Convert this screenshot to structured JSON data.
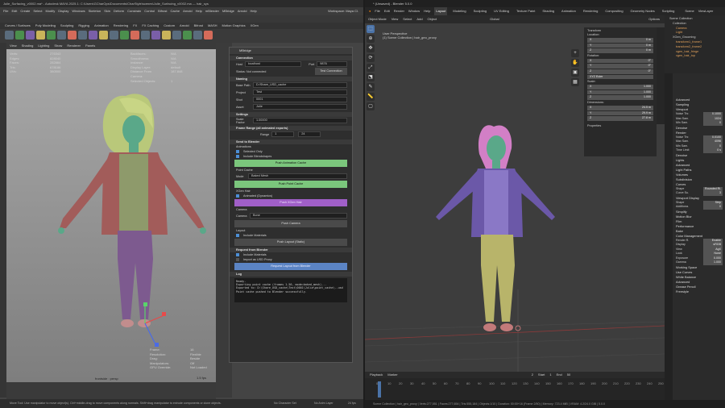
{
  "maya": {
    "title": "Julie_Surfacing_v0002.ma* - Autodesk MAYA 2025.1: C:\\Users\\GCharOps\\Documents\\CharStyle\\scenes\\Julie_Surfacing_v0002.ma --- hair_sys",
    "menu": [
      "File",
      "Edit",
      "Create",
      "Select",
      "Modify",
      "Display",
      "Windows",
      "Skeleton",
      "Skin",
      "Deform",
      "Constrain",
      "Control",
      "Bifrost",
      "Cache",
      "Arnold",
      "Help",
      "mBlender",
      "MBridge",
      "Arnold",
      "Help"
    ],
    "workspace": "Workspace: Maya Cl.",
    "shelf_tabs": [
      "Curves / Surfaces",
      "Poly Modeling",
      "Sculpting",
      "Rigging",
      "Animation",
      "Rendering",
      "FX",
      "FX Caching",
      "Custom",
      "Arnold",
      "Bifrost",
      "MASH",
      "Motion Graphics",
      "XGen",
      "TURTLE"
    ],
    "vp_menu": [
      "View",
      "Shading",
      "Lighting",
      "Show",
      "Renderer",
      "Panels"
    ],
    "hud": [
      [
        "Verts:",
        "276343",
        "",
        "Backfaces:",
        "N/A"
      ],
      [
        "Edges:",
        "828040",
        "",
        "Smoothness:",
        "N/A"
      ],
      [
        "Faces:",
        "282864",
        "",
        "Instance:",
        "N/A"
      ],
      [
        "Tris:",
        "678186",
        "",
        "Display Layer:",
        "default"
      ],
      [
        "UVs:",
        "380500",
        "",
        "Distance From Camera:",
        "187.848"
      ],
      [
        "",
        "",
        "",
        "Selected Objects:",
        "1"
      ]
    ],
    "hud_bottom": [
      [
        "Frame:",
        "16"
      ],
      [
        "Resolution:",
        "Flexible"
      ],
      [
        "Drag:",
        "Beside"
      ],
      [
        "Manipulators:",
        "Off"
      ],
      [
        "GPU Override:",
        "Not Loaded"
      ]
    ],
    "fps": "1.5 fps",
    "camera": "frontside : persp",
    "help": "Move Tool: Use manipulator to move object(s). Ctrl+middle-drag to move components along normals. Shift+drag manipulator to extrude components or clone objects.",
    "no_char_set": "No Character Set",
    "no_anim_layer": "No Anim Layer",
    "fps_end": "24 fps"
  },
  "mbridge": {
    "title": "MBridge",
    "connection": {
      "header": "Connection",
      "host_label": "Host",
      "host": "localhost",
      "port_label": "Port",
      "port": "9876",
      "status": "Status: Not connected",
      "test_btn": "Test Connection"
    },
    "naming": {
      "header": "Naming",
      "base_path_label": "Base Path",
      "base_path": "D:/Share_USD_cache",
      "project_label": "Project",
      "project": "Test",
      "shot_label": "Shot",
      "shot": "0001",
      "asset_label": "Asset",
      "asset": "Julie"
    },
    "settings": {
      "header": "Settings",
      "scale_label": "Scale Factor",
      "scale": "1.00000"
    },
    "frame_range": {
      "header": "Frame Range (all animated exports)",
      "range_label": "Range",
      "start": "1",
      "end": "24"
    },
    "send": {
      "header": "Send to Blender",
      "anim_label": "Animations",
      "sel_only": "Selected Only",
      "blendshapes": "Include Blendshapes",
      "push_anim": "Push Animation Cache",
      "point_cache": "Point Cache",
      "mode_label": "Mode",
      "mode": "Baked Mesh",
      "push_point": "Push Point Cache",
      "xgen_label": "XGen Hair",
      "animated": "Animated (Dynamics)",
      "push_xgen": "Push XGen Hair",
      "camera_label": "Camera",
      "camera_field": "Camera",
      "camera_val": "Bone",
      "push_camera": "Push Camera",
      "layout_label": "Layout",
      "incl_mat": "Include Materials",
      "push_layout": "Push Layout (Static)"
    },
    "request": {
      "header": "Request from Blender",
      "incl_mat": "Include Materials",
      "import_usd": "Import as USD Proxy",
      "btn": "Request Layout from Blender"
    },
    "log": {
      "header": "Log",
      "text": "Ready.\nExporting point cache (frames 1-50, mode=baked_mesh)...\nExported to: D:\\Share_USD_cache\\Test\\0001\\Julie\\point_cache\\..usd\nPoint cache pushed to Blender successfully."
    }
  },
  "blender": {
    "title": "* (Unsaved) - Blender 5.0.0",
    "menu": [
      "File",
      "Edit",
      "Render",
      "Window",
      "Help"
    ],
    "tabs": [
      "Layout",
      "Modeling",
      "Sculpting",
      "UV Editing",
      "Texture Paint",
      "Shading",
      "Animation",
      "Rendering",
      "Compositing",
      "Geometry Nodes",
      "Scripting"
    ],
    "active_tab": "Layout",
    "scene": "Scene",
    "view_layer": "ViewLayer",
    "header": [
      "Object Mode",
      "View",
      "Select",
      "Add",
      "Object"
    ],
    "global": "Global",
    "options": "Options",
    "vp_label": "User Perspective",
    "vp_sub": "(1) Scene Collection | hair_geo_proxy",
    "transform": {
      "header": "Transform",
      "location": "Location:",
      "loc": [
        [
          "X",
          "0 m"
        ],
        [
          "Y",
          "0 m"
        ],
        [
          "Z",
          "0 m"
        ]
      ],
      "rotation": "Rotation:",
      "rot": [
        [
          "X",
          "0°"
        ],
        [
          "Y",
          "0°"
        ],
        [
          "Z",
          "0°"
        ]
      ],
      "mode": "XYZ Euler",
      "scale": "Scale:",
      "scl": [
        [
          "X",
          "1.000"
        ],
        [
          "Y",
          "1.000"
        ],
        [
          "Z",
          "1.000"
        ]
      ],
      "dimensions": "Dimensions:",
      "dim": [
        [
          "X",
          "24.5 m"
        ],
        [
          "Y",
          "29.9 m"
        ],
        [
          "Z",
          "27.8 m"
        ]
      ],
      "properties": "Properties"
    },
    "outliner": [
      "Scene Collection",
      "Collection",
      "Camera",
      "Light",
      "XGen_Grooming",
      "transform1_frame1",
      "transform2_frame2",
      "xgen_hair_fringe",
      "xgen_hair_top"
    ],
    "props": [
      [
        "Advanced",
        ""
      ],
      [
        "Sampling",
        ""
      ],
      [
        "Viewport",
        ""
      ],
      [
        "Noise Thr.",
        "0.1000"
      ],
      [
        "Max Sam.",
        "1024"
      ],
      [
        "Min Sam.",
        "0"
      ],
      [
        "Denoise",
        ""
      ],
      [
        "Render",
        ""
      ],
      [
        "Noise Thr.",
        "0.0100"
      ],
      [
        "Max Sam.",
        "4096"
      ],
      [
        "Min Sam.",
        "0"
      ],
      [
        "Time Limit",
        "0 s"
      ],
      [
        "Denoise",
        ""
      ],
      [
        "Lights",
        ""
      ],
      [
        "Advanced",
        ""
      ],
      [
        "Light Paths",
        ""
      ],
      [
        "Volumes",
        ""
      ],
      [
        "Subdivision",
        ""
      ],
      [
        "Curves",
        ""
      ],
      [
        "Shape",
        "Rounded Ri."
      ],
      [
        "Curve Su.",
        "3"
      ],
      [
        "Viewport Display",
        ""
      ],
      [
        "Shape",
        "Strip"
      ],
      [
        "Additiona.",
        "0"
      ],
      [
        "Simplify",
        ""
      ],
      [
        "Motion Blur",
        ""
      ],
      [
        "Film",
        ""
      ],
      [
        "Performance",
        ""
      ],
      [
        "Bake",
        ""
      ],
      [
        "Color Management",
        ""
      ],
      [
        "Render R.",
        "Enable"
      ],
      [
        "Display",
        "sRGB"
      ],
      [
        "View",
        "AgX"
      ],
      [
        "Look",
        "None"
      ],
      [
        "Exposure",
        "0.000"
      ],
      [
        "Gamma",
        "1.000"
      ],
      [
        "Working Space",
        ""
      ],
      [
        "Use Curves",
        ""
      ],
      [
        "White Balance",
        ""
      ],
      [
        "Advanced",
        ""
      ],
      [
        "Grease Pencil",
        ""
      ],
      [
        "Freestyle",
        ""
      ]
    ],
    "timeline": {
      "menu": [
        "Playback",
        "View",
        "Marker"
      ],
      "frame": "2",
      "start_label": "Start",
      "start": "1",
      "end_label": "End",
      "end": "50",
      "ticks": [
        "0",
        "10",
        "20",
        "30",
        "40",
        "50",
        "60",
        "70",
        "80",
        "90",
        "100",
        "110",
        "120",
        "130",
        "140",
        "150",
        "160",
        "170",
        "180",
        "190",
        "200",
        "210",
        "220",
        "230",
        "240",
        "250"
      ]
    },
    "status": "Scene Collection | hair_geo_proxy | Verts:277,551 | Faces:277,654 | Tris:555,184 | Objects:1/10 | Duration: 00:00+16 (Frame 2/50) | Memory: 723.4 MiB | VRAM: 4.2/24.0 GiB | 5.0.0"
  },
  "colors": {
    "green_btn": "#7bc67c",
    "purple_btn": "#a05fc8",
    "blue_btn": "#5b84c4",
    "skin": "#5aa889",
    "hair": "#b9c87a",
    "blender_hair": "#d27fc6"
  }
}
